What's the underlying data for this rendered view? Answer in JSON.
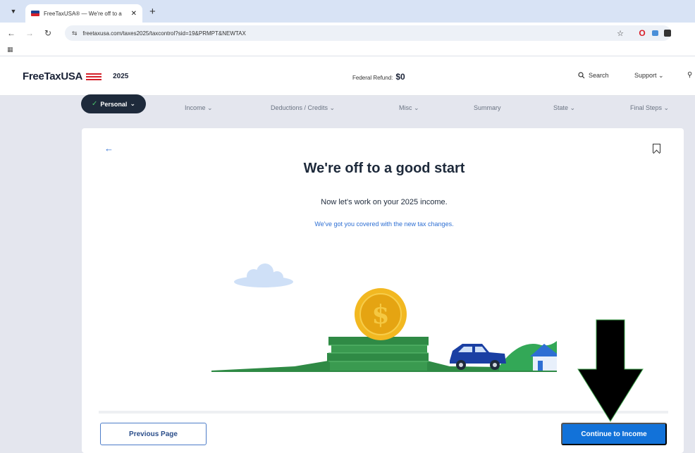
{
  "browser": {
    "tab_title": "FreeTaxUSA® — We're off to a",
    "url": "freetaxusa.com/taxes2025/taxcontrol?sid=19&PRMPT&NEWTAX"
  },
  "header": {
    "brand": "FreeTaxUSA",
    "year": "2025",
    "refund_label": "Federal Refund:",
    "refund_amount": "$0",
    "search_label": "Search",
    "support_label": "Support ⌄"
  },
  "steps": {
    "active": "Personal",
    "items": [
      {
        "label": "Income ⌄"
      },
      {
        "label": "Deductions / Credits ⌄"
      },
      {
        "label": "Misc ⌄"
      },
      {
        "label": "Summary"
      },
      {
        "label": "State ⌄"
      },
      {
        "label": "Final Steps ⌄"
      }
    ]
  },
  "main": {
    "headline": "We're off to a good start",
    "subline": "Now let's work on your 2025 income.",
    "link_text": "We've got you covered with the new tax changes."
  },
  "footer": {
    "previous_label": "Previous Page",
    "continue_label": "Continue to Income"
  },
  "colors": {
    "primary_blue": "#1272d9",
    "brand_red": "#d4202a",
    "nav_dark": "#1e2a3b",
    "coin_gold": "#f2b821",
    "money_green": "#2f8a45"
  },
  "icons": {
    "search": "search-icon",
    "back": "back-arrow-icon",
    "bookmark": "bookmark-icon",
    "user": "user-icon"
  }
}
